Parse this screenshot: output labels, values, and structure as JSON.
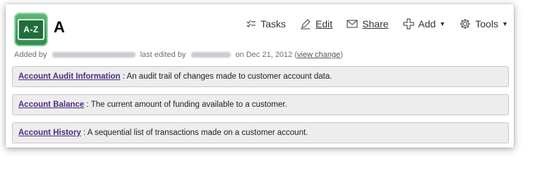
{
  "page": {
    "title": "A",
    "logo_text": "A-Z"
  },
  "toolbar": {
    "tasks": "Tasks",
    "edit": "Edit",
    "share": "Share",
    "add": "Add",
    "tools": "Tools"
  },
  "meta": {
    "added_by": "Added by",
    "last_edited_by": "last edited by",
    "on_date": "on Dec 21, 2012",
    "view_change": "view change"
  },
  "entries": [
    {
      "term": "Account Audit Information",
      "desc": " : An audit trail of changes made to customer account data."
    },
    {
      "term": "Account Balance",
      "desc": " : The current amount of funding available to a customer."
    },
    {
      "term": "Account History",
      "desc": " : A sequential list of transactions made on a customer account."
    }
  ],
  "colors": {
    "link": "#4b2e83",
    "logo_green": "#2f8a4d"
  }
}
